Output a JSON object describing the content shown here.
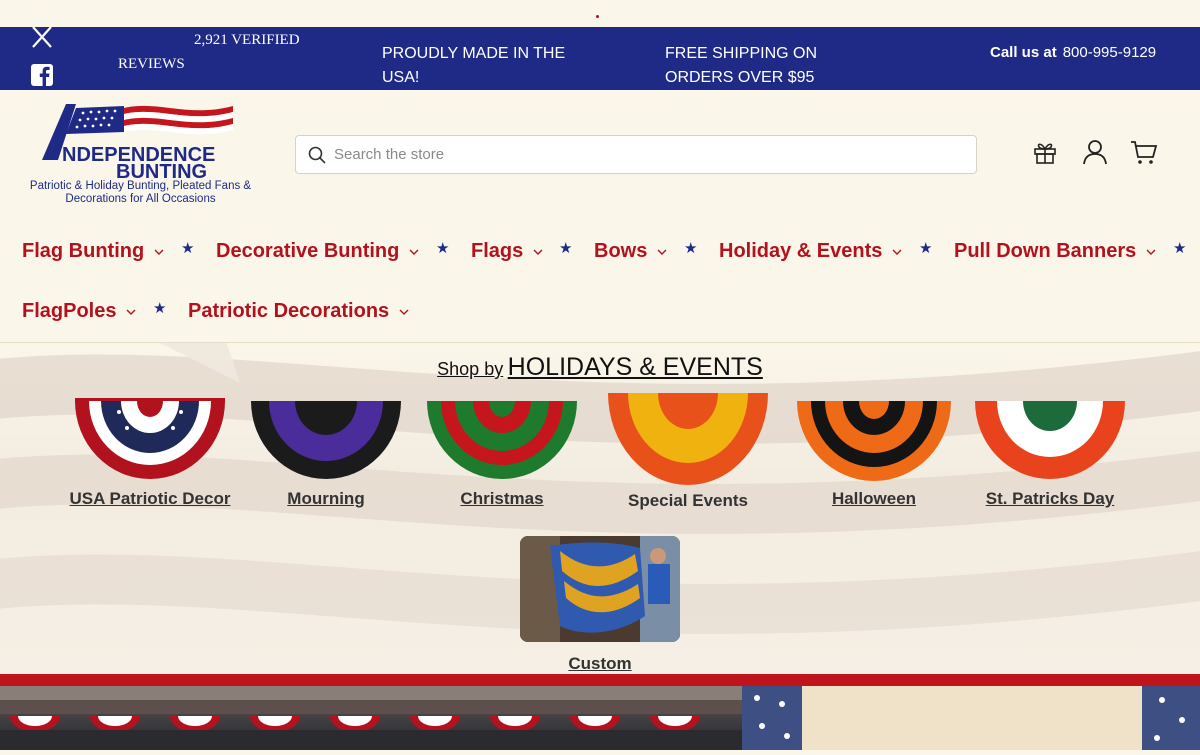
{
  "topbar": {
    "reviews_line1": "2,921 VERIFIED",
    "reviews_line2": "REVIEWS",
    "made_in_usa": "PROUDLY MADE IN THE USA!",
    "free_shipping": "FREE SHIPPING ON ORDERS OVER $95",
    "call_label": "Call us at",
    "phone": "800-995-9129",
    "social": [
      "x-icon",
      "facebook-icon"
    ]
  },
  "logo": {
    "line1": "NDEPENDENCE",
    "line2": "BUNTING",
    "tagline": "Patriotic & Holiday Bunting, Pleated Fans & Decorations for All Occasions"
  },
  "search": {
    "placeholder": "Search the store"
  },
  "header_icons": [
    "gift-icon",
    "account-icon",
    "cart-icon"
  ],
  "nav": {
    "items": [
      {
        "label": "Flag Bunting"
      },
      {
        "label": "Decorative Bunting"
      },
      {
        "label": "Flags"
      },
      {
        "label": "Bows"
      },
      {
        "label": "Holiday & Events"
      },
      {
        "label": "Pull Down Banners"
      },
      {
        "label": "FlagPoles"
      },
      {
        "label": "Patriotic Decorations"
      }
    ]
  },
  "shop_by": {
    "prefix": "Shop by",
    "title": "HOLIDAYS & EVENTS"
  },
  "categories": [
    {
      "label": "USA Patriotic Decor",
      "colors": [
        "#b2121d",
        "#ffffff",
        "#1f2a5a",
        "#ffffff",
        "#b2121d"
      ]
    },
    {
      "label": "Mourning",
      "colors": [
        "#1b1b1b",
        "#4a2d9a",
        "#1b1b1b"
      ]
    },
    {
      "label": "Christmas",
      "colors": [
        "#1e7a2c",
        "#c4161c",
        "#1e7a2c",
        "#c4161c"
      ]
    },
    {
      "label": "Special Events",
      "colors": [
        "#e8521a",
        "#f0b20f",
        "#e8521a"
      ]
    },
    {
      "label": "Halloween",
      "colors": [
        "#ee6a17",
        "#141414",
        "#ee6a17",
        "#141414"
      ]
    },
    {
      "label": "St. Patricks Day",
      "colors": [
        "#e8431c",
        "#ffffff",
        "#1d6b3a"
      ]
    }
  ],
  "custom": {
    "label": "Custom"
  },
  "colors": {
    "navy": "#1f2a87",
    "red": "#b2121d",
    "cream": "#fbf6ea"
  }
}
